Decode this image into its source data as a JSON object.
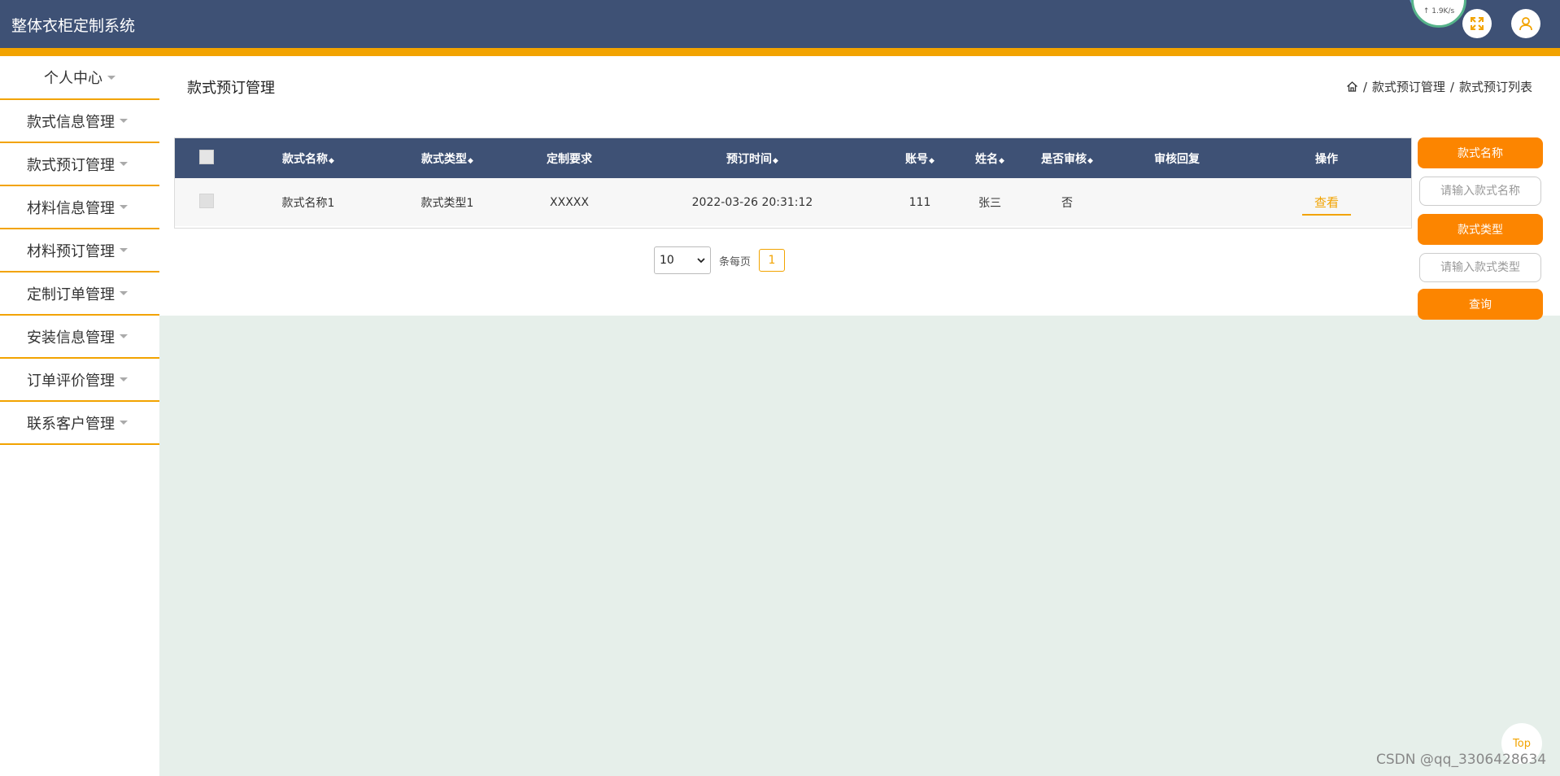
{
  "app": {
    "title": "整体衣柜定制系统",
    "speed_text": "↑ 1.9K/s"
  },
  "sidebar": {
    "items": [
      {
        "label": "个人中心"
      },
      {
        "label": "款式信息管理"
      },
      {
        "label": "款式预订管理"
      },
      {
        "label": "材料信息管理"
      },
      {
        "label": "材料预订管理"
      },
      {
        "label": "定制订单管理"
      },
      {
        "label": "安装信息管理"
      },
      {
        "label": "订单评价管理"
      },
      {
        "label": "联系客户管理"
      }
    ]
  },
  "page": {
    "title": "款式预订管理",
    "breadcrumb": {
      "separator": "/",
      "level1": "款式预订管理",
      "level2": "款式预订列表"
    }
  },
  "table": {
    "columns": [
      "款式名称",
      "款式类型",
      "定制要求",
      "预订时间",
      "账号",
      "姓名",
      "是否审核",
      "审核回复",
      "操作"
    ],
    "rows": [
      {
        "style_name": "款式名称1",
        "style_type": "款式类型1",
        "requirement": "XXXXX",
        "time": "2022-03-26 20:31:12",
        "account": "111",
        "name": "张三",
        "approved": "否",
        "reply": "",
        "action": "查看"
      }
    ]
  },
  "pager": {
    "page_size": "10",
    "per_page_label": "条每页",
    "current_page": "1"
  },
  "search": {
    "name_label": "款式名称",
    "name_placeholder": "请输入款式名称",
    "type_label": "款式类型",
    "type_placeholder": "请输入款式类型",
    "query_label": "查询"
  },
  "misc": {
    "top_label": "Top",
    "watermark": "CSDN @qq_3306428634"
  },
  "colors": {
    "header": "#3e5175",
    "accent": "#f2a300",
    "button": "#fc8500",
    "background": "#e6efea"
  }
}
